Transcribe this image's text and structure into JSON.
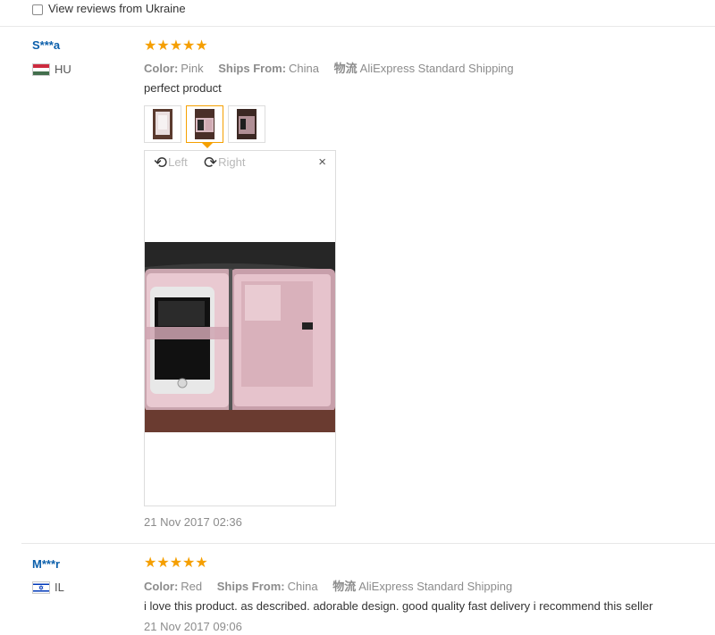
{
  "filter": {
    "label": "View reviews from Ukraine",
    "checked": false
  },
  "reviews": [
    {
      "user": "S***a",
      "country": "HU",
      "stars": "★★★★★",
      "rating": 5,
      "color_label": "Color:",
      "color_value": "Pink",
      "ships_label": "Ships From:",
      "ships_value": "China",
      "shipping_label": "物流",
      "shipping_value": "AliExpress Standard Shipping",
      "text": "perfect product",
      "viewer": {
        "left_label": "Left",
        "right_label": "Right",
        "close": "×"
      },
      "date": "21 Nov 2017 02:36"
    },
    {
      "user": "M***r",
      "country": "IL",
      "stars": "★★★★★",
      "rating": 5,
      "color_label": "Color:",
      "color_value": "Red",
      "ships_label": "Ships From:",
      "ships_value": "China",
      "shipping_label": "物流",
      "shipping_value": "AliExpress Standard Shipping",
      "text": "i love this product. as described. adorable design. good quality fast delivery i recommend this seller",
      "date": "21 Nov 2017 09:06"
    }
  ],
  "colors": {
    "link": "#0b5fab",
    "star": "#f59f00",
    "active_thumb": "#f5a000"
  },
  "icons": {
    "rotate_left": "rotate-left-icon",
    "rotate_right": "rotate-right-icon",
    "close": "close-icon"
  }
}
